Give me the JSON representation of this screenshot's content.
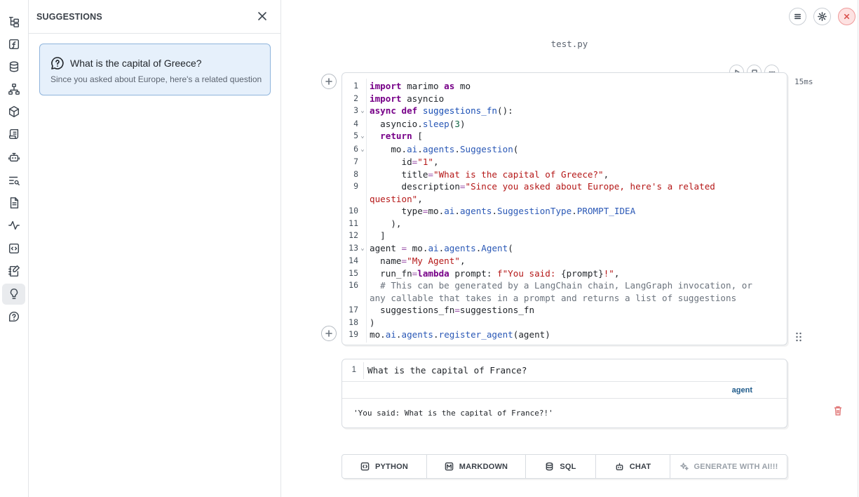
{
  "sidebar": {
    "items": [
      {
        "icon": "file-tree-icon"
      },
      {
        "icon": "function-icon"
      },
      {
        "icon": "database-icon"
      },
      {
        "icon": "dependency-graph-icon"
      },
      {
        "icon": "package-icon"
      },
      {
        "icon": "scroll-icon"
      },
      {
        "icon": "bot-icon"
      },
      {
        "icon": "search-list-icon"
      },
      {
        "icon": "document-icon"
      },
      {
        "icon": "activity-icon"
      },
      {
        "icon": "code-box-icon"
      },
      {
        "icon": "notebook-pen-icon"
      },
      {
        "icon": "lightbulb-icon",
        "active": true
      },
      {
        "icon": "help-icon"
      }
    ]
  },
  "suggestions_panel": {
    "title": "SUGGESTIONS",
    "card": {
      "title": "What is the capital of Greece?",
      "description": "Since you asked about Europe, here's a related question"
    }
  },
  "notebook": {
    "filename": "test.py",
    "code_cell": {
      "runtime": "15ms",
      "lines": [
        {
          "n": "1",
          "fold": false,
          "html": "<span class=\"kw\">import</span> marimo <span class=\"kw\">as</span> mo"
        },
        {
          "n": "2",
          "fold": false,
          "html": "<span class=\"kw\">import</span> asyncio"
        },
        {
          "n": "3",
          "fold": true,
          "html": "<span class=\"kw\">async</span> <span class=\"kw\">def</span> <span class=\"fn\">suggestions_fn</span>():"
        },
        {
          "n": "4",
          "fold": false,
          "html": "  asyncio.<span class=\"at\">sleep</span>(<span class=\"num\">3</span>)"
        },
        {
          "n": "5",
          "fold": true,
          "html": "  <span class=\"kw\">return</span> ["
        },
        {
          "n": "6",
          "fold": true,
          "html": "    mo.<span class=\"at\">ai</span>.<span class=\"at\">agents</span>.<span class=\"at\">Suggestion</span>("
        },
        {
          "n": "7",
          "fold": false,
          "html": "      id<span class=\"op\">=</span><span class=\"str\">\"1\"</span>,"
        },
        {
          "n": "8",
          "fold": false,
          "html": "      title<span class=\"op\">=</span><span class=\"str\">\"What is the capital of Greece?\"</span>,"
        },
        {
          "n": "9",
          "fold": false,
          "html": "      description<span class=\"op\">=</span><span class=\"str\">\"Since you asked about Europe, here's a related question\"</span>,"
        },
        {
          "n": "10",
          "fold": false,
          "html": "      type<span class=\"op\">=</span>mo.<span class=\"at\">ai</span>.<span class=\"at\">agents</span>.<span class=\"at\">SuggestionType</span>.<span class=\"at\">PROMPT_IDEA</span>"
        },
        {
          "n": "11",
          "fold": false,
          "html": "    ),"
        },
        {
          "n": "12",
          "fold": false,
          "html": "  ]"
        },
        {
          "n": "13",
          "fold": true,
          "html": "agent <span class=\"op\">=</span> mo.<span class=\"at\">ai</span>.<span class=\"at\">agents</span>.<span class=\"at\">Agent</span>("
        },
        {
          "n": "14",
          "fold": false,
          "html": "  name<span class=\"op\">=</span><span class=\"str\">\"My Agent\"</span>,"
        },
        {
          "n": "15",
          "fold": false,
          "html": "  run_fn<span class=\"op\">=</span><span class=\"kw\">lambda</span> prompt: <span class=\"str\">f\"You said: </span>{prompt}<span class=\"str\">!\"</span>,"
        },
        {
          "n": "16",
          "fold": false,
          "html": "  <span class=\"cm\"># This can be generated by a LangChain chain, LangGraph invocation, or any callable that takes in a prompt and returns a list of suggestions</span>"
        },
        {
          "n": "17",
          "fold": false,
          "html": "  suggestions_fn<span class=\"op\">=</span>suggestions_fn"
        },
        {
          "n": "18",
          "fold": false,
          "html": ")"
        },
        {
          "n": "19",
          "fold": false,
          "html": "mo.<span class=\"at\">ai</span>.<span class=\"at\">agents</span>.<span class=\"at\">register_agent</span>(agent)"
        }
      ]
    },
    "chat_cell": {
      "line_number": "1",
      "input": "What is the capital of France?",
      "tag": "agent",
      "output": "'You said: What is the capital of France?!'"
    },
    "add_buttons": [
      {
        "label": "PYTHON",
        "icon": "code-brackets-icon"
      },
      {
        "label": "MARKDOWN",
        "icon": "markdown-icon"
      },
      {
        "label": "SQL",
        "icon": "database-icon"
      },
      {
        "label": "CHAT",
        "icon": "bot-icon"
      },
      {
        "label": "GENERATE WITH AI!!!",
        "icon": "sparkles-icon"
      }
    ]
  }
}
